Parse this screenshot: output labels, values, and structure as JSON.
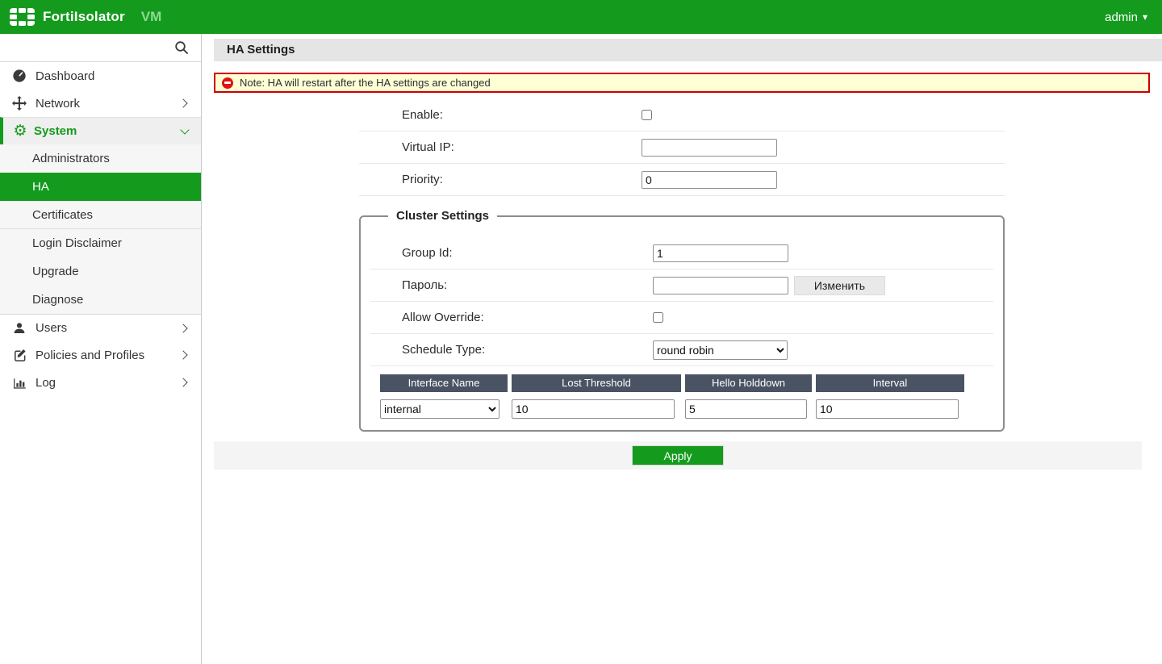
{
  "topbar": {
    "brand": "FortiIsolator",
    "product": "VM",
    "user_menu": "admin"
  },
  "sidebar": {
    "items": [
      {
        "label": "Dashboard"
      },
      {
        "label": "Network"
      },
      {
        "label": "System"
      },
      {
        "label": "Administrators"
      },
      {
        "label": "HA"
      },
      {
        "label": "Certificates"
      },
      {
        "label": "Login Disclaimer"
      },
      {
        "label": "Upgrade"
      },
      {
        "label": "Diagnose"
      },
      {
        "label": "Users"
      },
      {
        "label": "Policies and Profiles"
      },
      {
        "label": "Log"
      }
    ]
  },
  "main": {
    "title": "HA Settings",
    "note": "Note: HA will restart after the HA settings are changed",
    "fields": {
      "enable_label": "Enable:",
      "virtual_ip_label": "Virtual IP:",
      "virtual_ip_value": "",
      "priority_label": "Priority:",
      "priority_value": "0"
    },
    "cluster": {
      "legend": "Cluster Settings",
      "group_id_label": "Group Id:",
      "group_id_value": "1",
      "password_label": "Пароль:",
      "password_value": "",
      "change_button": "Изменить",
      "allow_override_label": "Allow Override:",
      "schedule_type_label": "Schedule Type:",
      "schedule_type_value": "round robin",
      "table": {
        "headers": [
          "Interface Name",
          "Lost Threshold",
          "Hello Holddown",
          "Interval"
        ],
        "row": {
          "interface": "internal",
          "lost_threshold": "10",
          "hello_holddown": "5",
          "interval": "10"
        }
      }
    },
    "apply_button": "Apply"
  },
  "colors": {
    "brand_green": "#149b1d",
    "table_header": "#4a5364",
    "note_background": "#ffffd6",
    "note_border": "#cc0000"
  }
}
